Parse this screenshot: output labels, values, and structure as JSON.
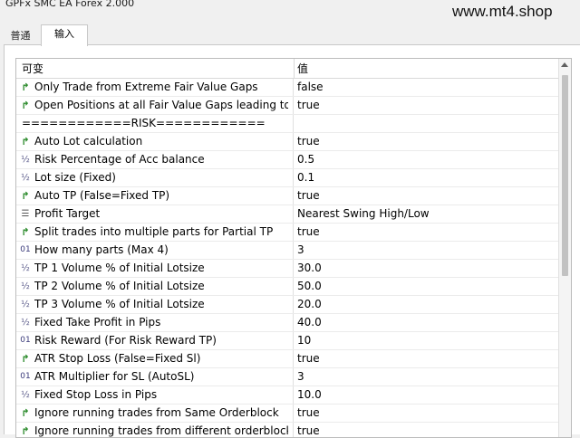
{
  "window": {
    "title": "GPFx SMC EA Forex 2.000"
  },
  "watermark": "www.mt4.shop",
  "tabs": [
    {
      "label": "普通"
    },
    {
      "label": "输入"
    }
  ],
  "grid": {
    "header": {
      "variable": "可变",
      "value": "值"
    },
    "rows": [
      {
        "icon": "bool-arrow-icon",
        "name": "Only Trade from Extreme Fair Value Gaps",
        "value": "false"
      },
      {
        "icon": "bool-arrow-icon",
        "name": "Open Positions at all Fair Value Gaps leading to ...",
        "value": "true"
      },
      {
        "icon": "",
        "name": "============RISK============",
        "value": ""
      },
      {
        "icon": "bool-arrow-icon",
        "name": "Auto Lot calculation",
        "value": "true"
      },
      {
        "icon": "double-icon",
        "name": "Risk Percentage of Acc balance",
        "value": "0.5"
      },
      {
        "icon": "double-icon",
        "name": "Lot size (Fixed)",
        "value": "0.1"
      },
      {
        "icon": "bool-arrow-icon",
        "name": "Auto TP (False=Fixed TP)",
        "value": "true"
      },
      {
        "icon": "enum-icon",
        "name": "Profit Target",
        "value": "Nearest Swing High/Low"
      },
      {
        "icon": "bool-arrow-icon",
        "name": "Split trades into multiple parts for Partial TP",
        "value": "true"
      },
      {
        "icon": "int-icon",
        "name": "How many parts (Max 4)",
        "value": "3"
      },
      {
        "icon": "double-icon",
        "name": "TP 1 Volume % of Initial Lotsize",
        "value": "30.0"
      },
      {
        "icon": "double-icon",
        "name": "TP 2 Volume % of Initial Lotsize",
        "value": "50.0"
      },
      {
        "icon": "double-icon",
        "name": "TP 3 Volume % of Initial Lotsize",
        "value": "20.0"
      },
      {
        "icon": "double-icon",
        "name": "Fixed Take Profit in Pips",
        "value": "40.0"
      },
      {
        "icon": "int-icon",
        "name": "Risk Reward (For Risk Reward TP)",
        "value": "10"
      },
      {
        "icon": "bool-arrow-icon",
        "name": "ATR Stop Loss (False=Fixed Sl)",
        "value": "true"
      },
      {
        "icon": "int-icon",
        "name": "ATR Multiplier for SL (AutoSL)",
        "value": "3"
      },
      {
        "icon": "double-icon",
        "name": "Fixed Stop Loss in Pips",
        "value": "10.0"
      },
      {
        "icon": "bool-arrow-icon",
        "name": "Ignore running trades from Same Orderblock",
        "value": "true"
      },
      {
        "icon": "bool-arrow-icon",
        "name": "Ignore running trades from different orderblock",
        "value": "true"
      }
    ]
  }
}
